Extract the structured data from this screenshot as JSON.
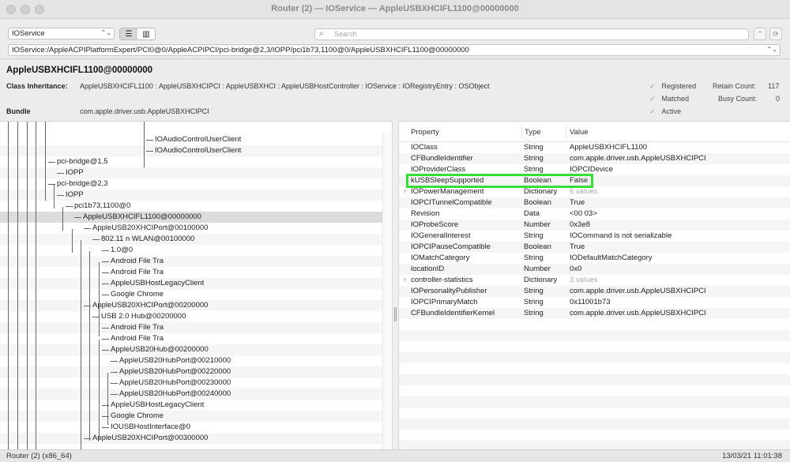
{
  "window": {
    "title": "Router (2) — IOService — AppleUSBXHCIFL1100@00000000"
  },
  "toolbar": {
    "plane_select": "IOService",
    "search_placeholder": "Search",
    "path": "IOService:/AppleACPIPlatformExpert/PCI0@0/AppleACPIPCI/pci-bridge@2,3/IOPP/pci1b73,1100@0/AppleUSBXHCIFL1100@00000000"
  },
  "info": {
    "object_title": "AppleUSBXHCIFL1100@00000000",
    "class_label": "Class Inheritance:",
    "class_value": "AppleUSBXHCIFL1100 : AppleUSBXHCIPCI : AppleUSBXHCI : AppleUSBHostController : IOService : IORegistryEntry : OSObject",
    "bundle_label": "Bundle",
    "bundle_value": "com.apple.driver.usb.AppleUSBXHCIPCI",
    "flags": [
      "Registered",
      "Matched",
      "Active"
    ],
    "retain_label": "Retain Count:",
    "retain_value": "117",
    "busy_label": "Busy Count:",
    "busy_value": "0"
  },
  "tree": [
    "IOAudioControlUserClient",
    "IOAudioControlUserClient",
    "pci-bridge@1,5",
    "IOPP",
    "pci-bridge@2,3",
    "IOPP",
    "pci1b73,1100@0",
    "AppleUSBXHCIFL1100@00000000",
    "AppleUSB20XHCIPort@00100000",
    "802.11 n WLAN@00100000",
    "1.0@0",
    "Android File Tra",
    "Android File Tra",
    "AppleUSBHostLegacyClient",
    "Google Chrome",
    "AppleUSB20XHCIPort@00200000",
    "USB 2.0 Hub@00200000",
    "Android File Tra",
    "Android File Tra",
    "AppleUSB20Hub@00200000",
    "AppleUSB20HubPort@00210000",
    "AppleUSB20HubPort@00220000",
    "AppleUSB20HubPort@00230000",
    "AppleUSB20HubPort@00240000",
    "AppleUSBHostLegacyClient",
    "Google Chrome",
    "IOUSBHostInterface@0",
    "AppleUSB20XHCIPort@00300000"
  ],
  "properties": {
    "headers": [
      "Property",
      "Type",
      "Value"
    ],
    "rows": [
      [
        "IOClass",
        "String",
        "AppleUSBXHCIFL1100"
      ],
      [
        "CFBundleIdentifier",
        "String",
        "com.apple.driver.usb.AppleUSBXHCIPCI"
      ],
      [
        "IOProviderClass",
        "String",
        "IOPCIDevice"
      ],
      [
        "kUSBSleepSupported",
        "Boolean",
        "False"
      ],
      [
        "IOPowerManagement",
        "Dictionary",
        "6 values"
      ],
      [
        "IOPCITunnelCompatible",
        "Boolean",
        "True"
      ],
      [
        "Revision",
        "Data",
        "<00 03>"
      ],
      [
        "IOProbeScore",
        "Number",
        "0x3e8"
      ],
      [
        "IOGeneralInterest",
        "String",
        "IOCommand is not serializable"
      ],
      [
        "IOPCIPauseCompatible",
        "Boolean",
        "True"
      ],
      [
        "IOMatchCategory",
        "String",
        "IODefaultMatchCategory"
      ],
      [
        "locationID",
        "Number",
        "0x0"
      ],
      [
        "controller-statistics",
        "Dictionary",
        "3 values"
      ],
      [
        "IOPersonalityPublisher",
        "String",
        "com.apple.driver.usb.AppleUSBXHCIPCI"
      ],
      [
        "IOPCIPrimaryMatch",
        "String",
        "0x11001b73"
      ],
      [
        "CFBundleIdentifierKernel",
        "String",
        "com.apple.driver.usb.AppleUSBXHCIPCI"
      ]
    ]
  },
  "status": {
    "left": "Router (2) (x86_64)",
    "right": "13/03/21 11:01:38"
  }
}
